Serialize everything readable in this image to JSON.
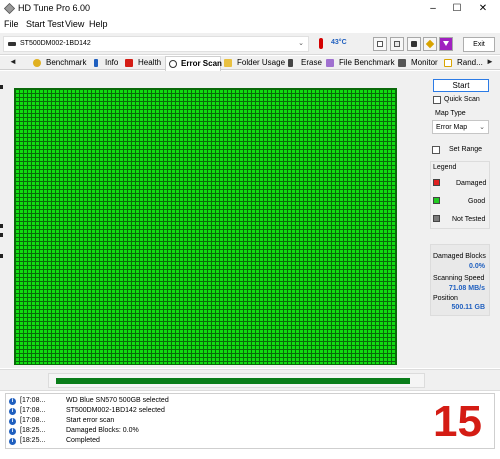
{
  "window": {
    "title": "HD Tune Pro 6.00",
    "controls": {
      "minimize": "–",
      "maximize": "☐",
      "close": "✕"
    }
  },
  "menu": [
    "File",
    "Start Test",
    "View",
    "Help"
  ],
  "toolbar": {
    "drive": "ST500DM002-1BD142",
    "temperature": "43°C",
    "exit_label": "Exit",
    "tool_icons": [
      "copy-icon",
      "paste-icon",
      "camera-icon",
      "save-icon",
      "download-icon"
    ]
  },
  "tabs": {
    "nav_left": "◄",
    "nav_right": "►",
    "items": [
      {
        "label": "Benchmark",
        "icon": "benchmark-icon",
        "active": false
      },
      {
        "label": "Info",
        "icon": "info-icon",
        "active": false
      },
      {
        "label": "Health",
        "icon": "health-icon",
        "active": false
      },
      {
        "label": "Error Scan",
        "icon": "error-scan-icon",
        "active": true
      },
      {
        "label": "Folder Usage",
        "icon": "folder-icon",
        "active": false
      },
      {
        "label": "Erase",
        "icon": "erase-icon",
        "active": false
      },
      {
        "label": "File Benchmark",
        "icon": "file-benchmark-icon",
        "active": false
      },
      {
        "label": "Monitor",
        "icon": "monitor-icon",
        "active": false
      },
      {
        "label": "Rand...",
        "icon": "random-icon",
        "active": false
      }
    ]
  },
  "side_panel": {
    "start_label": "Start",
    "quick_scan_label": "Quick Scan",
    "map_type_label": "Map Type",
    "map_type_value": "Error Map",
    "set_range_label": "Set Range",
    "legend_title": "Legend",
    "legend": [
      {
        "label": "Damaged",
        "color": "#e02020"
      },
      {
        "label": "Good",
        "color": "#22cc22"
      },
      {
        "label": "Not Tested",
        "color": "#7a7a7a"
      }
    ]
  },
  "stats": {
    "damaged_blocks_label": "Damaged Blocks",
    "damaged_blocks_value": "0.0%",
    "scanning_speed_label": "Scanning Speed",
    "scanning_speed_value": "71.08 MB/s",
    "position_label": "Position",
    "position_value": "500.11 GB"
  },
  "progress": {
    "fraction": 0.98
  },
  "log": [
    {
      "time": "[17:08...",
      "message": "WD Blue SN570 500GB     selected"
    },
    {
      "time": "[17:08...",
      "message": "ST500DM002-1BD142 selected"
    },
    {
      "time": "[17:08...",
      "message": "Start error scan"
    },
    {
      "time": "[18:25...",
      "message": "Damaged Blocks: 0.0%"
    },
    {
      "time": "[18:25...",
      "message": "Completed"
    }
  ],
  "overlay_number": "15",
  "colors": {
    "map_good": "#11dd11",
    "map_grid": "#0a6a0a",
    "progress": "#0a7d1a",
    "accent_blue": "#1f5fbf",
    "overlay_red": "#d41c14"
  }
}
